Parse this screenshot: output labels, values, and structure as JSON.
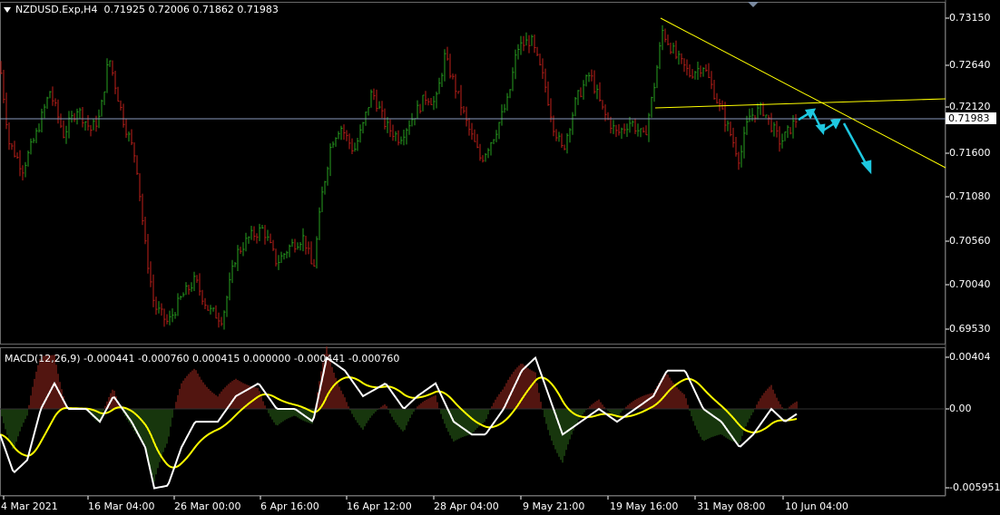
{
  "header": {
    "symbol": "NZDUSD.Exp,H4",
    "ohlc": "0.71925 0.72006 0.71862 0.71983"
  },
  "macd": {
    "label": "MACD(12,26,9) -0.000441 -0.000760 0.000415 0.000000 -0.000441 -0.000760",
    "axis": [
      "0.00404",
      "0.00",
      "-0.005951"
    ]
  },
  "price_axis": [
    "0.73150",
    "0.72640",
    "0.72120",
    "0.71600",
    "0.71080",
    "0.70560",
    "0.70040",
    "0.69530"
  ],
  "current_price": "0.71983",
  "time_axis": [
    "4 Mar 2021",
    "16 Mar 04:00",
    "26 Mar 00:00",
    "6 Apr 16:00",
    "16 Apr 12:00",
    "28 Apr 04:00",
    "9 May 21:00",
    "19 May 16:00",
    "31 May 08:00",
    "10 Jun 04:00"
  ],
  "colors": {
    "bull": "#27a020",
    "bear": "#c0201a",
    "macd_line": "#ffffff",
    "signal_line": "#ffff00",
    "trendline": "#ffff00",
    "price_line": "#8899bb",
    "arrows": "#1ec8e0"
  },
  "chart_data": {
    "type": "candlestick",
    "symbol": "NZDUSD",
    "timeframe": "H4",
    "ylim": [
      0.692,
      0.7335
    ],
    "price_path": [
      [
        0,
        0.726
      ],
      [
        10,
        0.717
      ],
      [
        25,
        0.714
      ],
      [
        40,
        0.718
      ],
      [
        55,
        0.723
      ],
      [
        70,
        0.718
      ],
      [
        85,
        0.721
      ],
      [
        100,
        0.7185
      ],
      [
        110,
        0.72
      ],
      [
        120,
        0.727
      ],
      [
        135,
        0.72
      ],
      [
        150,
        0.715
      ],
      [
        160,
        0.705
      ],
      [
        170,
        0.698
      ],
      [
        185,
        0.696
      ],
      [
        200,
        0.699
      ],
      [
        215,
        0.701
      ],
      [
        230,
        0.6975
      ],
      [
        245,
        0.6965
      ],
      [
        260,
        0.704
      ],
      [
        275,
        0.706
      ],
      [
        290,
        0.707
      ],
      [
        305,
        0.703
      ],
      [
        320,
        0.705
      ],
      [
        335,
        0.706
      ],
      [
        345,
        0.702
      ],
      [
        355,
        0.711
      ],
      [
        365,
        0.717
      ],
      [
        375,
        0.719
      ],
      [
        390,
        0.716
      ],
      [
        400,
        0.719
      ],
      [
        410,
        0.723
      ],
      [
        425,
        0.719
      ],
      [
        440,
        0.7175
      ],
      [
        455,
        0.72
      ],
      [
        470,
        0.7225
      ],
      [
        480,
        0.7215
      ],
      [
        490,
        0.727
      ],
      [
        500,
        0.724
      ],
      [
        515,
        0.719
      ],
      [
        530,
        0.715
      ],
      [
        545,
        0.718
      ],
      [
        560,
        0.722
      ],
      [
        570,
        0.728
      ],
      [
        585,
        0.729
      ],
      [
        600,
        0.724
      ],
      [
        610,
        0.719
      ],
      [
        620,
        0.716
      ],
      [
        635,
        0.722
      ],
      [
        650,
        0.725
      ],
      [
        665,
        0.7205
      ],
      [
        680,
        0.718
      ],
      [
        695,
        0.7195
      ],
      [
        710,
        0.7175
      ],
      [
        720,
        0.723
      ],
      [
        730,
        0.73
      ],
      [
        745,
        0.727
      ],
      [
        760,
        0.725
      ],
      [
        775,
        0.726
      ],
      [
        790,
        0.722
      ],
      [
        805,
        0.718
      ],
      [
        815,
        0.715
      ],
      [
        825,
        0.72
      ],
      [
        840,
        0.721
      ],
      [
        850,
        0.719
      ],
      [
        860,
        0.717
      ],
      [
        870,
        0.7185
      ],
      [
        878,
        0.7198
      ]
    ],
    "macd_path": [
      [
        0,
        -0.002
      ],
      [
        15,
        -0.005
      ],
      [
        30,
        -0.004
      ],
      [
        45,
        0.0
      ],
      [
        60,
        0.002
      ],
      [
        75,
        0.0
      ],
      [
        95,
        0.0
      ],
      [
        110,
        -0.001
      ],
      [
        125,
        0.001
      ],
      [
        145,
        -0.001
      ],
      [
        160,
        -0.003
      ],
      [
        170,
        -0.0062
      ],
      [
        185,
        -0.006
      ],
      [
        200,
        -0.003
      ],
      [
        215,
        -0.001
      ],
      [
        240,
        -0.001
      ],
      [
        260,
        0.001
      ],
      [
        285,
        0.002
      ],
      [
        305,
        0.0
      ],
      [
        325,
        0.0
      ],
      [
        345,
        -0.001
      ],
      [
        360,
        0.004
      ],
      [
        380,
        0.003
      ],
      [
        400,
        0.001
      ],
      [
        425,
        0.002
      ],
      [
        445,
        0.0
      ],
      [
        460,
        0.001
      ],
      [
        480,
        0.002
      ],
      [
        500,
        -0.001
      ],
      [
        520,
        -0.002
      ],
      [
        535,
        -0.002
      ],
      [
        555,
        0.0
      ],
      [
        575,
        0.003
      ],
      [
        590,
        0.004
      ],
      [
        605,
        0.001
      ],
      [
        620,
        -0.002
      ],
      [
        640,
        -0.001
      ],
      [
        660,
        0.0
      ],
      [
        680,
        -0.001
      ],
      [
        700,
        0.0
      ],
      [
        720,
        0.001
      ],
      [
        735,
        0.003
      ],
      [
        755,
        0.003
      ],
      [
        775,
        0.0
      ],
      [
        795,
        -0.001
      ],
      [
        815,
        -0.003
      ],
      [
        830,
        -0.002
      ],
      [
        850,
        0.0
      ],
      [
        865,
        -0.001
      ],
      [
        878,
        -0.0004
      ]
    ]
  }
}
